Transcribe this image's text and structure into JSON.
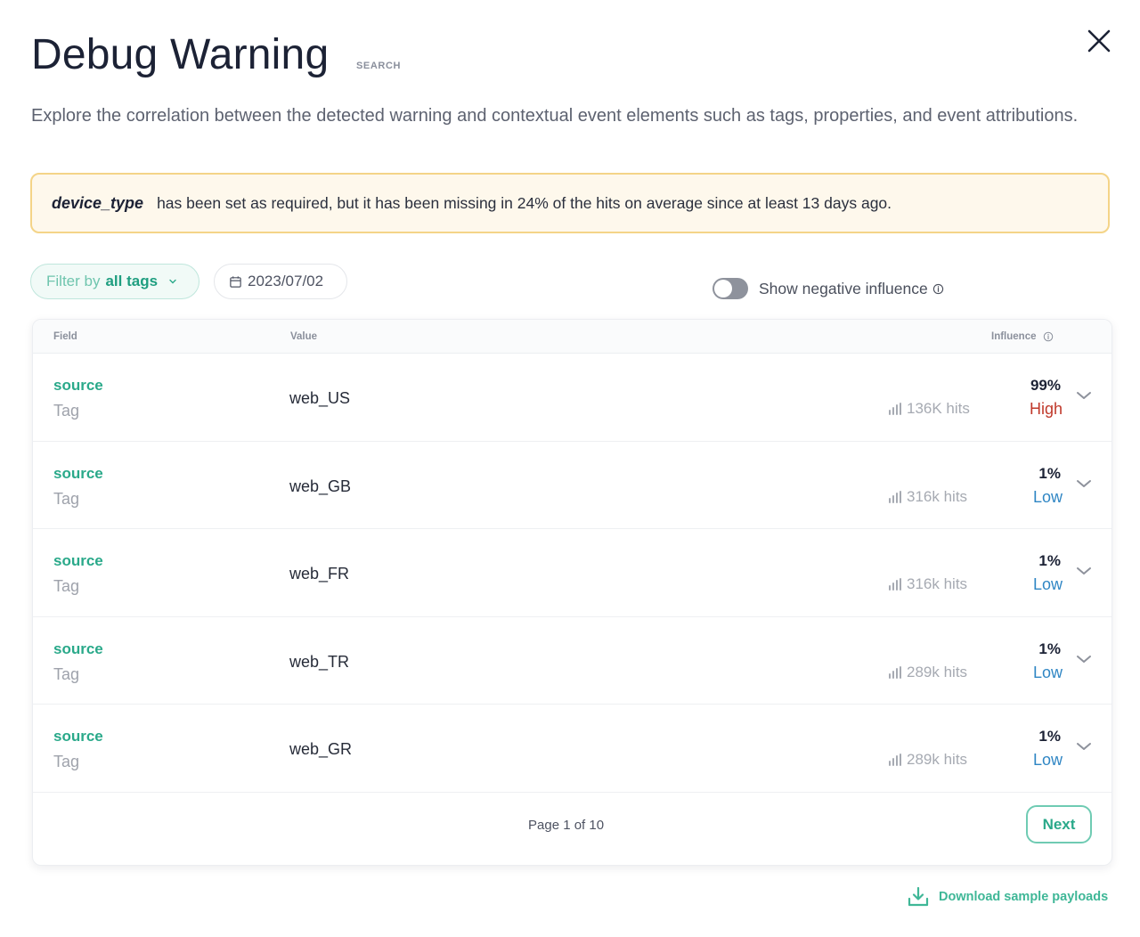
{
  "header": {
    "title": "Debug Warning",
    "search_tag": "SEARCH",
    "close_label": "close"
  },
  "description": "Explore the correlation between the detected warning and contextual event elements such as tags, properties, and event attributions.",
  "alert": {
    "field": "device_type",
    "message": "has been set as required, but it has been missing in 24% of the hits on average since at least 13 days ago."
  },
  "filters": {
    "filter_prefix": "Filter by",
    "filter_value": "all tags",
    "date": "2023/07/02"
  },
  "toggle": {
    "label": "Show negative influence",
    "enabled": false
  },
  "table": {
    "columns": {
      "field": "Field",
      "value": "Value",
      "influence": "Influence"
    },
    "rows": [
      {
        "field": "source",
        "type": "Tag",
        "value": "web_US",
        "hits": "136K hits",
        "percent": "99%",
        "level": "High"
      },
      {
        "field": "source",
        "type": "Tag",
        "value": "web_GB",
        "hits": "316k hits",
        "percent": "1%",
        "level": "Low"
      },
      {
        "field": "source",
        "type": "Tag",
        "value": "web_FR",
        "hits": "316k hits",
        "percent": "1%",
        "level": "Low"
      },
      {
        "field": "source",
        "type": "Tag",
        "value": "web_TR",
        "hits": "289k hits",
        "percent": "1%",
        "level": "Low"
      },
      {
        "field": "source",
        "type": "Tag",
        "value": "web_GR",
        "hits": "289k hits",
        "percent": "1%",
        "level": "Low"
      }
    ],
    "pagination": {
      "page_info": "Page 1 of 10",
      "next_label": "Next"
    }
  },
  "download": {
    "label": "Download sample payloads"
  },
  "colors": {
    "accent": "#2aa98a",
    "alert_border": "#f4d488",
    "alert_bg": "#fef8ec",
    "level_high": "#c0392b",
    "level_low": "#2f86c4"
  },
  "icons": {
    "close": "close-icon",
    "chevron": "chevron-down-icon",
    "calendar": "calendar-icon",
    "info": "info-icon",
    "bars": "bar-chart-icon",
    "download": "download-icon"
  }
}
